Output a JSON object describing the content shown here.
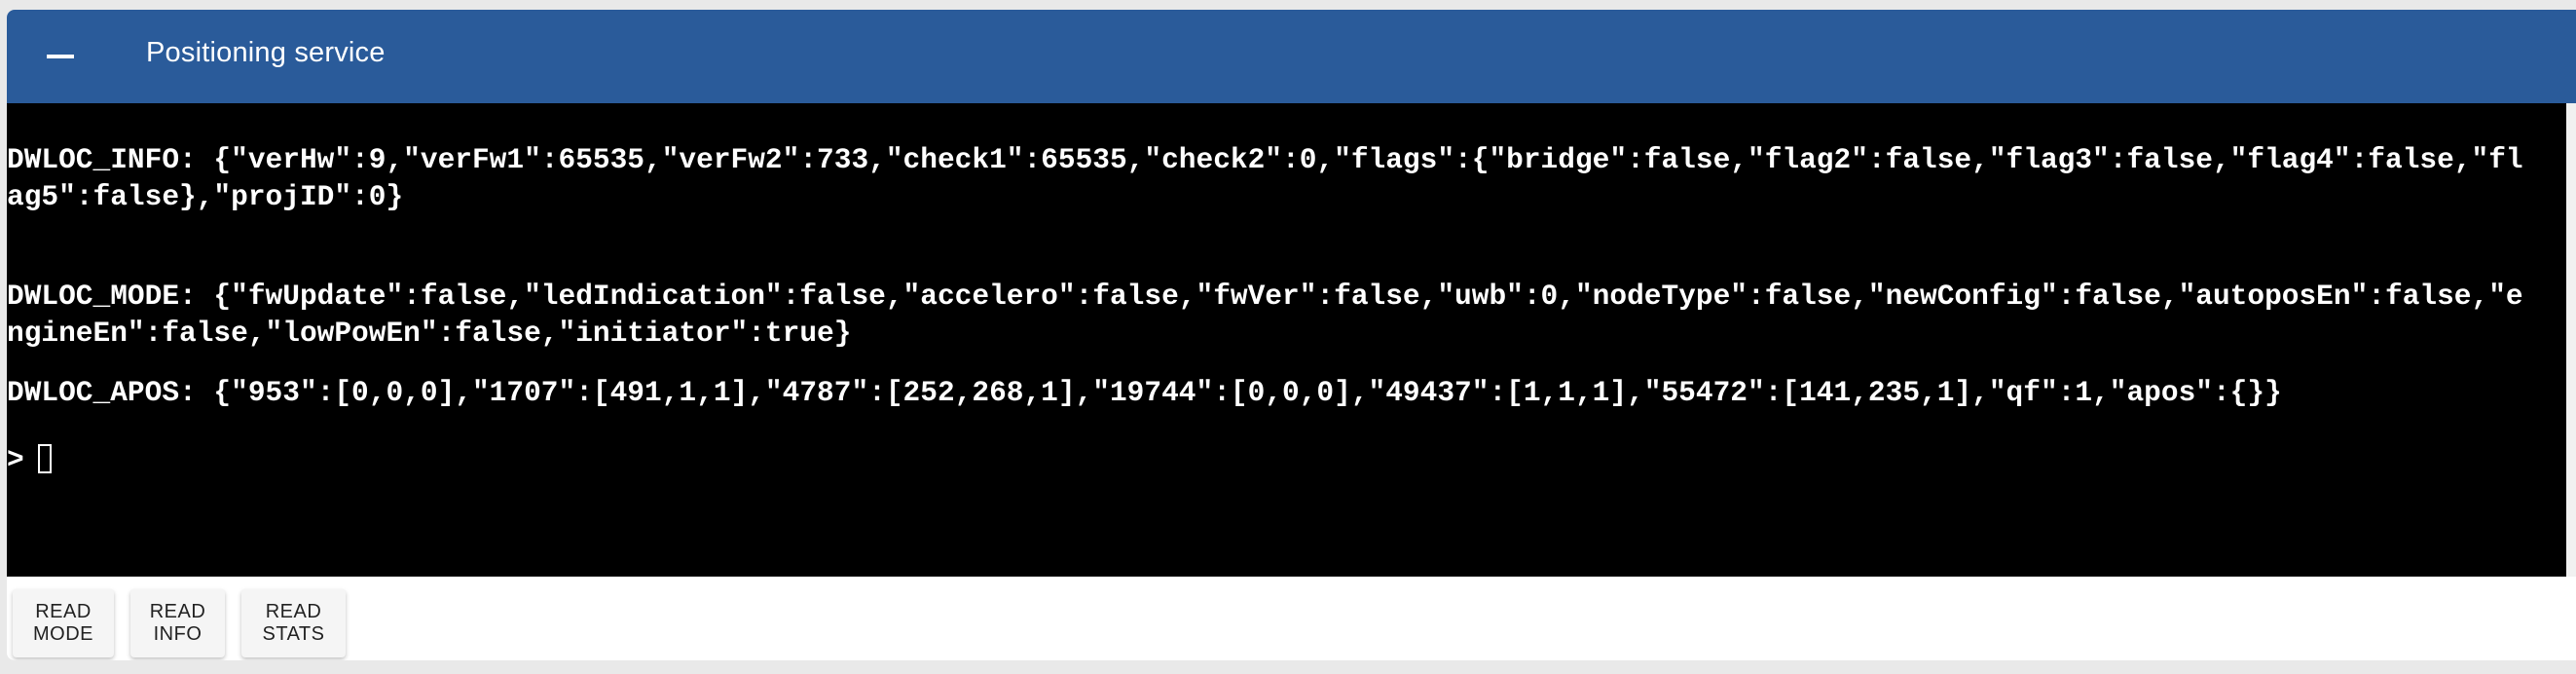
{
  "header": {
    "title": "Positioning service",
    "collapse_icon": "minus-icon"
  },
  "terminal": {
    "lines": [
      "DWLOC_INFO: {\"verHw\":9,\"verFw1\":65535,\"verFw2\":733,\"check1\":65535,\"check2\":0,\"flags\":{\"bridge\":false,\"flag2\":false,\"flag3\":false,\"flag4\":false,\"fl",
      "ag5\":false},\"projID\":0}",
      "DWLOC_MODE: {\"fwUpdate\":false,\"ledIndication\":false,\"accelero\":false,\"fwVer\":false,\"uwb\":0,\"nodeType\":false,\"newConfig\":false,\"autoposEn\":false,\"e",
      "ngineEn\":false,\"lowPowEn\":false,\"initiator\":true}",
      "DWLOC_APOS: {\"953\":[0,0,0],\"1707\":[491,1,1],\"4787\":[252,268,1],\"19744\":[0,0,0],\"49437\":[1,1,1],\"55472\":[141,235,1],\"qf\":1,\"apos\":{}}"
    ],
    "prompt": ">"
  },
  "buttons": {
    "read_mode": "READ MODE",
    "read_info": "READ INFO",
    "read_stats": "READ STATS"
  },
  "colors": {
    "header": "#2a5b9a",
    "terminal_bg": "#000000"
  }
}
